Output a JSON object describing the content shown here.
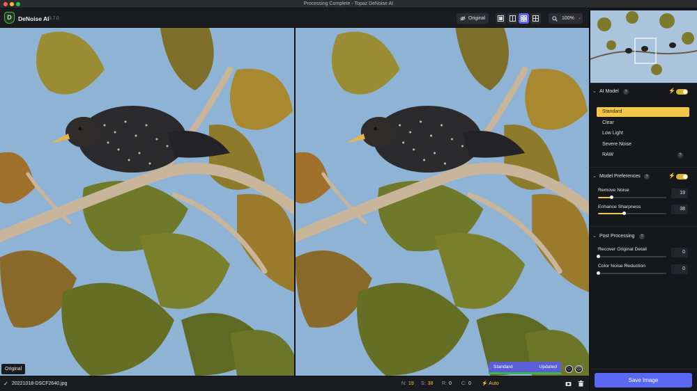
{
  "window": {
    "title": "Processing Complete - Topaz DeNoise AI"
  },
  "app": {
    "logo_letter": "D",
    "name": "DeNoise AI",
    "version": "v3.7.0"
  },
  "toolbar": {
    "original_label": "Original",
    "view_modes": [
      "single-view-icon",
      "split-view-icon",
      "side-by-side-view-icon",
      "quad-view-icon"
    ],
    "active_view": "side-by-side-view-icon",
    "zoom": "100%"
  },
  "preview": {
    "left_label": "Original",
    "model_chip": {
      "model": "Standard",
      "status": "Updated"
    },
    "status_colors": {
      "chip": "#5a5fd8",
      "underline": "#3fb44a"
    }
  },
  "statusbar": {
    "filename": "20221018-DSCF2640.jpg",
    "stats": [
      {
        "key": "N:",
        "value": "19"
      },
      {
        "key": "S:",
        "value": "38"
      },
      {
        "key": "R:",
        "value": "0"
      },
      {
        "key": "C:",
        "value": "0"
      }
    ],
    "auto_label": "Auto"
  },
  "panel": {
    "ai_model": {
      "title": "AI Model",
      "help": "?",
      "enabled": true,
      "items": [
        "Standard",
        "Clear",
        "Low Light",
        "Severe Noise",
        "RAW"
      ],
      "selected": "Standard"
    },
    "model_preferences": {
      "title": "Model Preferences",
      "help": "?",
      "enabled": true,
      "sliders": [
        {
          "label": "Remove Noise",
          "value": "19",
          "level": 0.19
        },
        {
          "label": "Enhance Sharpness",
          "value": "38",
          "level": 0.38
        }
      ]
    },
    "post_processing": {
      "title": "Post Processing",
      "help": "?",
      "sliders": [
        {
          "label": "Recover Original Detail",
          "value": "0",
          "level": 0
        },
        {
          "label": "Color Noise Reduction",
          "value": "0",
          "level": 0
        }
      ]
    },
    "save_label": "Save Image"
  },
  "colors": {
    "accent": "#5a67f2",
    "highlight": "#f1c64b",
    "background": "#1b1c20"
  }
}
